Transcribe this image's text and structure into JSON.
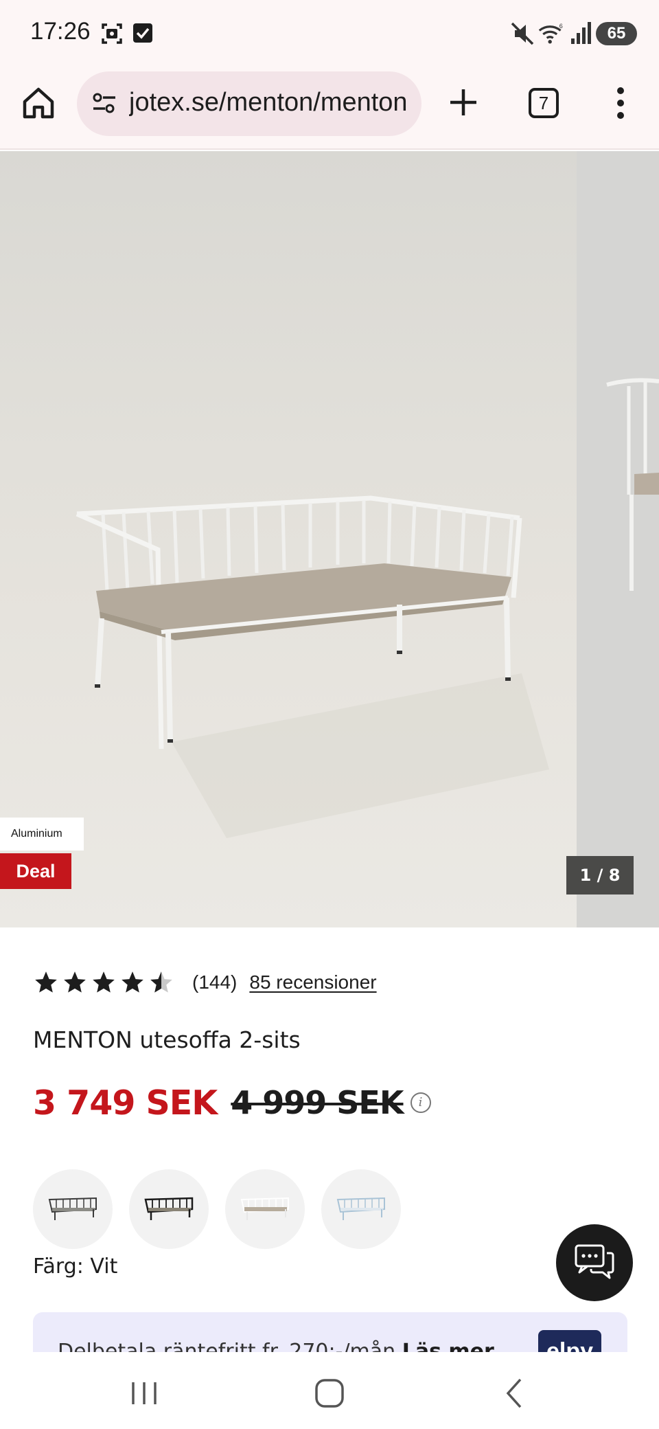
{
  "status_bar": {
    "time": "17:26",
    "battery": "65",
    "icons": [
      "screenshot-icon",
      "checkbox-icon",
      "mute-icon",
      "wifi-icon",
      "signal-icon",
      "battery-icon"
    ]
  },
  "browser": {
    "url": "jotex.se/menton/menton",
    "tab_count": "7",
    "icons": [
      "home-icon",
      "tune-icon",
      "plus-icon",
      "tabs-icon",
      "more-vert-icon"
    ]
  },
  "gallery": {
    "material_tag": "Aluminium",
    "deal_badge": "Deal",
    "counter": "1 / 8"
  },
  "product": {
    "rating": 4.5,
    "rating_count": "(144)",
    "reviews_link": "85 recensioner",
    "title": "MENTON utesoffa 2-sits",
    "price_now": "3 749 SEK",
    "price_old": "4 999 SEK",
    "color_label": "Färg: Vit",
    "swatches": [
      "dark-grey",
      "black",
      "white",
      "light-blue"
    ]
  },
  "installment": {
    "text": "Delbetala räntefritt fr. 270:-/mån",
    "link": "Läs mer",
    "logo": "elpy"
  },
  "colors": {
    "accent_red": "#c4161c",
    "status_bg": "#fdf6f6",
    "url_bg": "#f3e4e8",
    "installment_bg": "#ecebfb"
  }
}
